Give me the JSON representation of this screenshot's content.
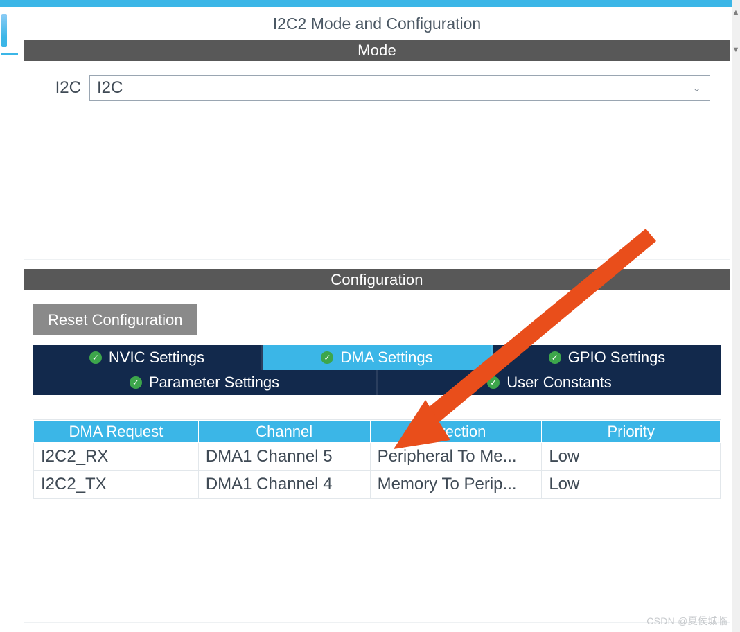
{
  "page_title": "I2C2 Mode and Configuration",
  "mode": {
    "header": "Mode",
    "field_label": "I2C",
    "selected_value": "I2C"
  },
  "configuration": {
    "header": "Configuration",
    "reset_label": "Reset Configuration",
    "tabs_row1": [
      {
        "label": "NVIC Settings",
        "active": false
      },
      {
        "label": "DMA Settings",
        "active": true
      },
      {
        "label": "GPIO Settings",
        "active": false
      }
    ],
    "tabs_row2": [
      {
        "label": "Parameter Settings",
        "active": false
      },
      {
        "label": "User Constants",
        "active": false
      }
    ]
  },
  "dma_table": {
    "headers": [
      "DMA Request",
      "Channel",
      "Direction",
      "Priority"
    ],
    "rows": [
      {
        "request": "I2C2_RX",
        "channel": "DMA1 Channel 5",
        "direction": "Peripheral To Me...",
        "priority": "Low"
      },
      {
        "request": "I2C2_TX",
        "channel": "DMA1 Channel 4",
        "direction": "Memory To Perip...",
        "priority": "Low"
      }
    ]
  },
  "watermark": "CSDN @夏侯城临",
  "colors": {
    "cyan": "#3bb6e7",
    "darknav": "#12294c",
    "section_grey": "#585858",
    "reset_grey": "#8a8a8a",
    "accent_green": "#3da64b",
    "arrow_red": "#e94e1b"
  }
}
